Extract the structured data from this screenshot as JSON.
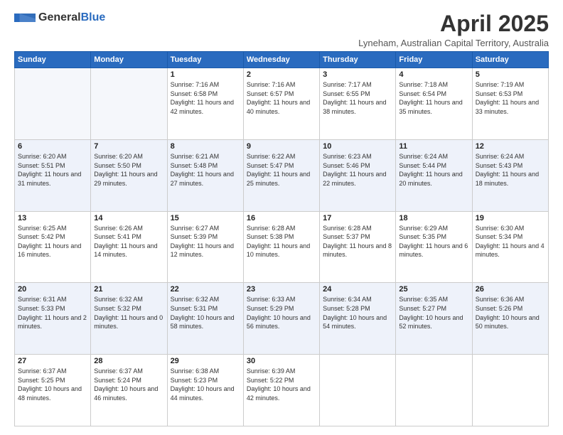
{
  "logo": {
    "general": "General",
    "blue": "Blue"
  },
  "title": "April 2025",
  "subtitle": "Lyneham, Australian Capital Territory, Australia",
  "headers": [
    "Sunday",
    "Monday",
    "Tuesday",
    "Wednesday",
    "Thursday",
    "Friday",
    "Saturday"
  ],
  "weeks": [
    [
      {
        "day": "",
        "sunrise": "",
        "sunset": "",
        "daylight": ""
      },
      {
        "day": "",
        "sunrise": "",
        "sunset": "",
        "daylight": ""
      },
      {
        "day": "1",
        "sunrise": "Sunrise: 7:16 AM",
        "sunset": "Sunset: 6:58 PM",
        "daylight": "Daylight: 11 hours and 42 minutes."
      },
      {
        "day": "2",
        "sunrise": "Sunrise: 7:16 AM",
        "sunset": "Sunset: 6:57 PM",
        "daylight": "Daylight: 11 hours and 40 minutes."
      },
      {
        "day": "3",
        "sunrise": "Sunrise: 7:17 AM",
        "sunset": "Sunset: 6:55 PM",
        "daylight": "Daylight: 11 hours and 38 minutes."
      },
      {
        "day": "4",
        "sunrise": "Sunrise: 7:18 AM",
        "sunset": "Sunset: 6:54 PM",
        "daylight": "Daylight: 11 hours and 35 minutes."
      },
      {
        "day": "5",
        "sunrise": "Sunrise: 7:19 AM",
        "sunset": "Sunset: 6:53 PM",
        "daylight": "Daylight: 11 hours and 33 minutes."
      }
    ],
    [
      {
        "day": "6",
        "sunrise": "Sunrise: 6:20 AM",
        "sunset": "Sunset: 5:51 PM",
        "daylight": "Daylight: 11 hours and 31 minutes."
      },
      {
        "day": "7",
        "sunrise": "Sunrise: 6:20 AM",
        "sunset": "Sunset: 5:50 PM",
        "daylight": "Daylight: 11 hours and 29 minutes."
      },
      {
        "day": "8",
        "sunrise": "Sunrise: 6:21 AM",
        "sunset": "Sunset: 5:48 PM",
        "daylight": "Daylight: 11 hours and 27 minutes."
      },
      {
        "day": "9",
        "sunrise": "Sunrise: 6:22 AM",
        "sunset": "Sunset: 5:47 PM",
        "daylight": "Daylight: 11 hours and 25 minutes."
      },
      {
        "day": "10",
        "sunrise": "Sunrise: 6:23 AM",
        "sunset": "Sunset: 5:46 PM",
        "daylight": "Daylight: 11 hours and 22 minutes."
      },
      {
        "day": "11",
        "sunrise": "Sunrise: 6:24 AM",
        "sunset": "Sunset: 5:44 PM",
        "daylight": "Daylight: 11 hours and 20 minutes."
      },
      {
        "day": "12",
        "sunrise": "Sunrise: 6:24 AM",
        "sunset": "Sunset: 5:43 PM",
        "daylight": "Daylight: 11 hours and 18 minutes."
      }
    ],
    [
      {
        "day": "13",
        "sunrise": "Sunrise: 6:25 AM",
        "sunset": "Sunset: 5:42 PM",
        "daylight": "Daylight: 11 hours and 16 minutes."
      },
      {
        "day": "14",
        "sunrise": "Sunrise: 6:26 AM",
        "sunset": "Sunset: 5:41 PM",
        "daylight": "Daylight: 11 hours and 14 minutes."
      },
      {
        "day": "15",
        "sunrise": "Sunrise: 6:27 AM",
        "sunset": "Sunset: 5:39 PM",
        "daylight": "Daylight: 11 hours and 12 minutes."
      },
      {
        "day": "16",
        "sunrise": "Sunrise: 6:28 AM",
        "sunset": "Sunset: 5:38 PM",
        "daylight": "Daylight: 11 hours and 10 minutes."
      },
      {
        "day": "17",
        "sunrise": "Sunrise: 6:28 AM",
        "sunset": "Sunset: 5:37 PM",
        "daylight": "Daylight: 11 hours and 8 minutes."
      },
      {
        "day": "18",
        "sunrise": "Sunrise: 6:29 AM",
        "sunset": "Sunset: 5:35 PM",
        "daylight": "Daylight: 11 hours and 6 minutes."
      },
      {
        "day": "19",
        "sunrise": "Sunrise: 6:30 AM",
        "sunset": "Sunset: 5:34 PM",
        "daylight": "Daylight: 11 hours and 4 minutes."
      }
    ],
    [
      {
        "day": "20",
        "sunrise": "Sunrise: 6:31 AM",
        "sunset": "Sunset: 5:33 PM",
        "daylight": "Daylight: 11 hours and 2 minutes."
      },
      {
        "day": "21",
        "sunrise": "Sunrise: 6:32 AM",
        "sunset": "Sunset: 5:32 PM",
        "daylight": "Daylight: 11 hours and 0 minutes."
      },
      {
        "day": "22",
        "sunrise": "Sunrise: 6:32 AM",
        "sunset": "Sunset: 5:31 PM",
        "daylight": "Daylight: 10 hours and 58 minutes."
      },
      {
        "day": "23",
        "sunrise": "Sunrise: 6:33 AM",
        "sunset": "Sunset: 5:29 PM",
        "daylight": "Daylight: 10 hours and 56 minutes."
      },
      {
        "day": "24",
        "sunrise": "Sunrise: 6:34 AM",
        "sunset": "Sunset: 5:28 PM",
        "daylight": "Daylight: 10 hours and 54 minutes."
      },
      {
        "day": "25",
        "sunrise": "Sunrise: 6:35 AM",
        "sunset": "Sunset: 5:27 PM",
        "daylight": "Daylight: 10 hours and 52 minutes."
      },
      {
        "day": "26",
        "sunrise": "Sunrise: 6:36 AM",
        "sunset": "Sunset: 5:26 PM",
        "daylight": "Daylight: 10 hours and 50 minutes."
      }
    ],
    [
      {
        "day": "27",
        "sunrise": "Sunrise: 6:37 AM",
        "sunset": "Sunset: 5:25 PM",
        "daylight": "Daylight: 10 hours and 48 minutes."
      },
      {
        "day": "28",
        "sunrise": "Sunrise: 6:37 AM",
        "sunset": "Sunset: 5:24 PM",
        "daylight": "Daylight: 10 hours and 46 minutes."
      },
      {
        "day": "29",
        "sunrise": "Sunrise: 6:38 AM",
        "sunset": "Sunset: 5:23 PM",
        "daylight": "Daylight: 10 hours and 44 minutes."
      },
      {
        "day": "30",
        "sunrise": "Sunrise: 6:39 AM",
        "sunset": "Sunset: 5:22 PM",
        "daylight": "Daylight: 10 hours and 42 minutes."
      },
      {
        "day": "",
        "sunrise": "",
        "sunset": "",
        "daylight": ""
      },
      {
        "day": "",
        "sunrise": "",
        "sunset": "",
        "daylight": ""
      },
      {
        "day": "",
        "sunrise": "",
        "sunset": "",
        "daylight": ""
      }
    ]
  ]
}
